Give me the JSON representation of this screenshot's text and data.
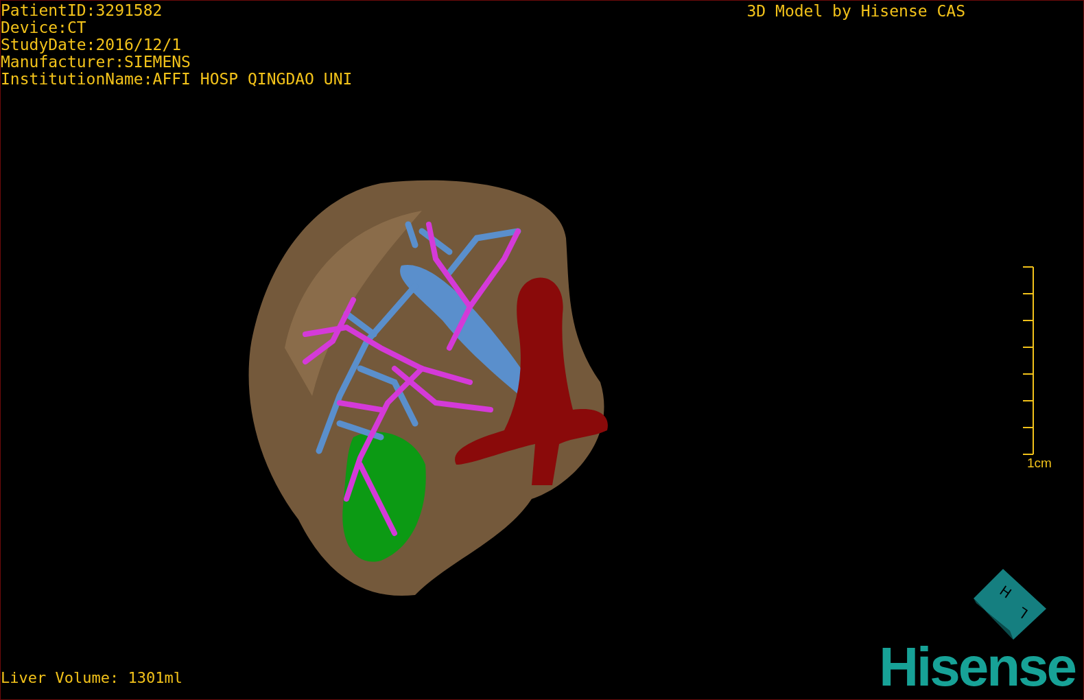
{
  "info_lines": [
    "PatientID:3291582",
    "Device:CT",
    "StudyDate:2016/12/1",
    "Manufacturer:SIEMENS",
    "InstitutionName:AFFI HOSP QINGDAO UNI"
  ],
  "credit": "3D Model by Hisense CAS",
  "scale_bar": {
    "label": "1cm"
  },
  "volume": "Liver Volume: 1301ml",
  "orientation_cube": {
    "labels": [
      "H",
      "L"
    ]
  },
  "logo": "Hisense"
}
